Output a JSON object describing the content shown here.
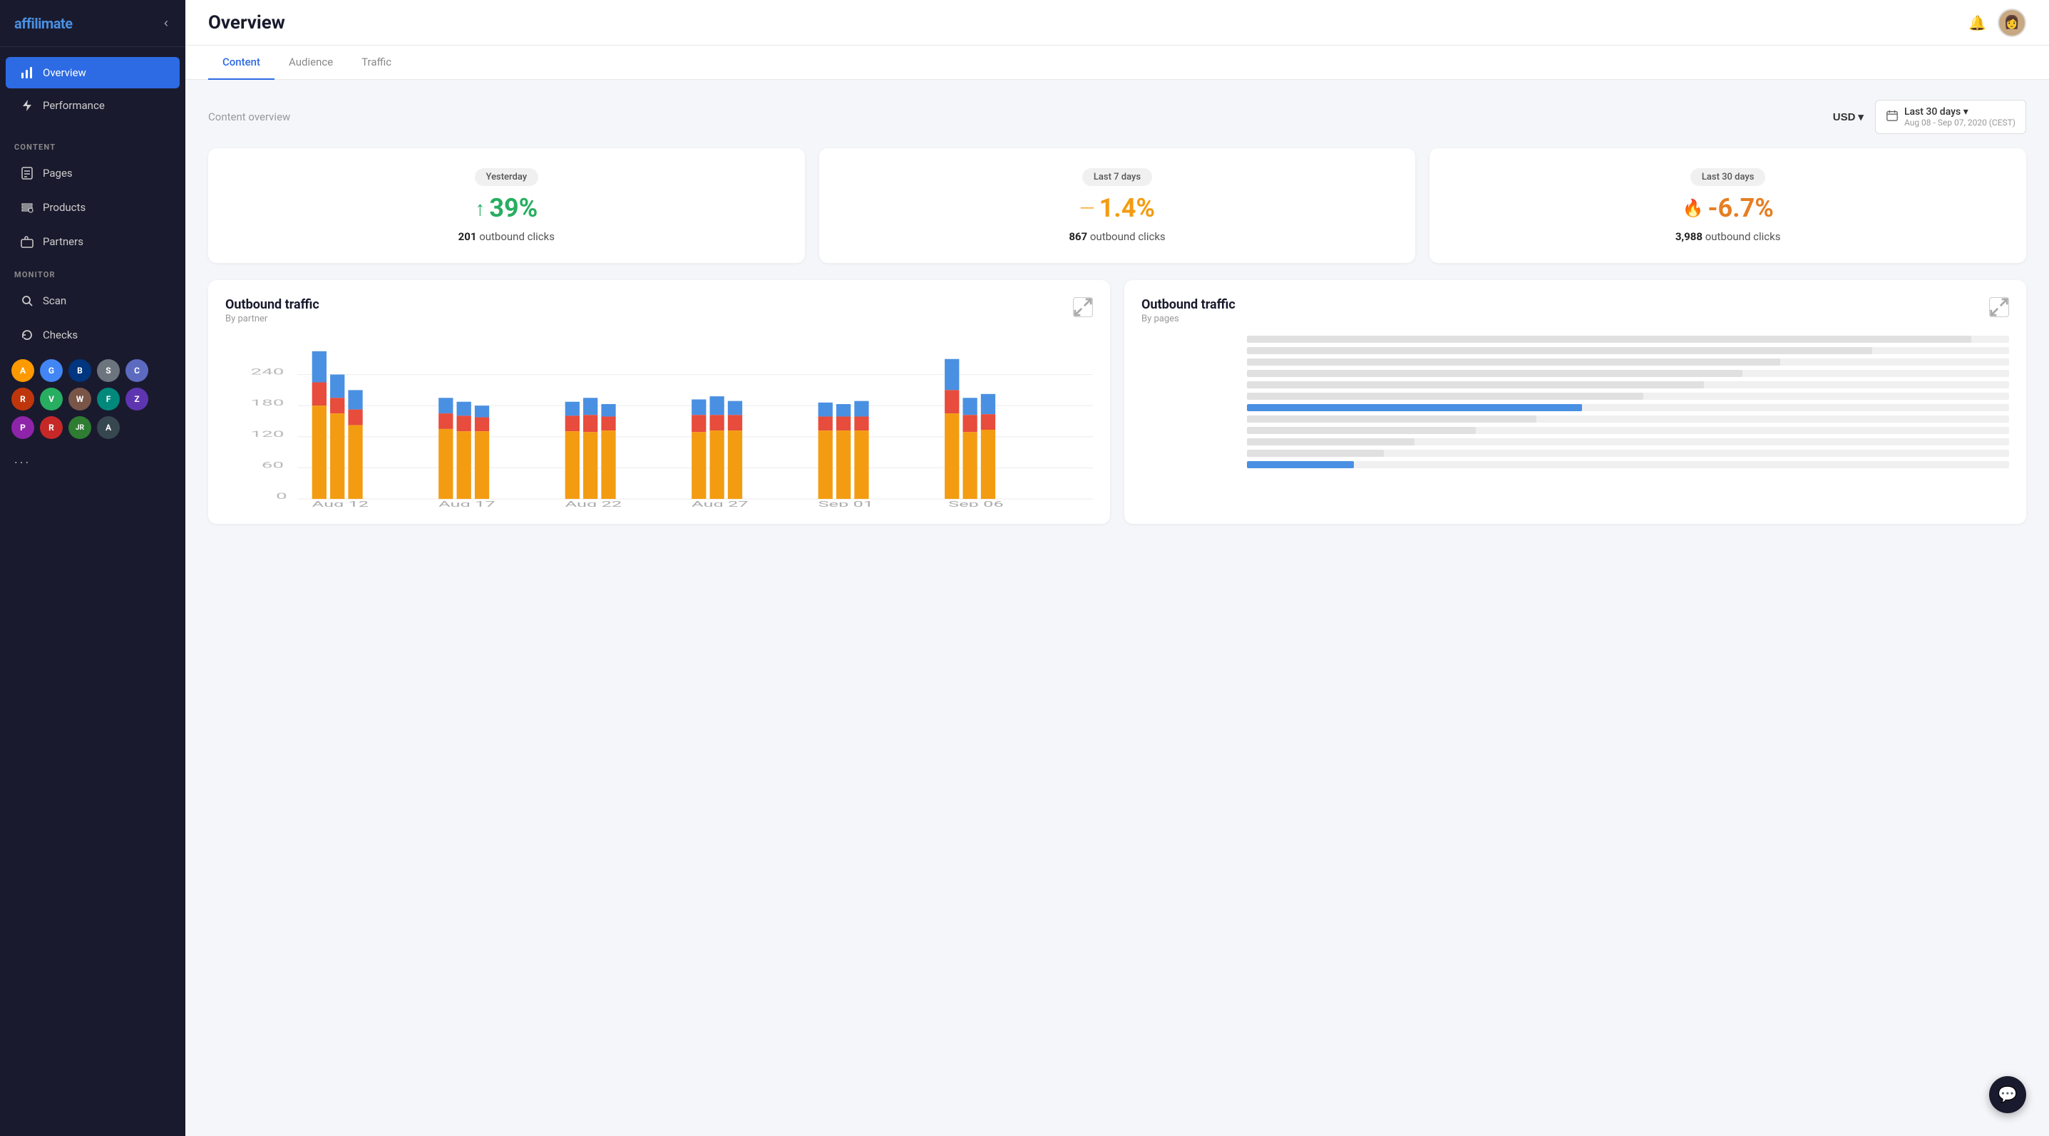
{
  "app": {
    "name": "affili",
    "name_accent": "mate"
  },
  "sidebar": {
    "collapse_label": "‹",
    "nav_items": [
      {
        "id": "overview",
        "label": "Overview",
        "active": true,
        "icon": "chart-bar"
      },
      {
        "id": "performance",
        "label": "Performance",
        "active": false,
        "icon": "lightning"
      }
    ],
    "sections": [
      {
        "label": "CONTENT",
        "items": [
          {
            "id": "pages",
            "label": "Pages",
            "icon": "page"
          },
          {
            "id": "products",
            "label": "Products",
            "icon": "products"
          },
          {
            "id": "partners",
            "label": "Partners",
            "icon": "briefcase"
          }
        ]
      },
      {
        "label": "MONITOR",
        "items": [
          {
            "id": "scan",
            "label": "Scan",
            "icon": "search"
          },
          {
            "id": "checks",
            "label": "Checks",
            "icon": "refresh"
          }
        ]
      }
    ],
    "partners": [
      {
        "id": "amazon",
        "label": "A",
        "color": "#FF9900"
      },
      {
        "id": "google",
        "label": "G",
        "color": "#4285F4"
      },
      {
        "id": "booking",
        "label": "B",
        "color": "#003580"
      },
      {
        "id": "shareasale",
        "label": "S",
        "color": "#6c757d"
      },
      {
        "id": "cj",
        "label": "C",
        "color": "#5c6bc0"
      },
      {
        "id": "rakuten",
        "label": "R",
        "color": "#bf360c"
      },
      {
        "id": "viator",
        "label": "V",
        "color": "#27ae60"
      },
      {
        "id": "p2",
        "label": "W",
        "color": "#795548"
      },
      {
        "id": "fp",
        "label": "F",
        "color": "#00897b"
      },
      {
        "id": "p3",
        "label": "Z",
        "color": "#5e35b1"
      },
      {
        "id": "p4",
        "label": "P",
        "color": "#8e24aa"
      },
      {
        "id": "p5",
        "label": "R",
        "color": "#c62828"
      },
      {
        "id": "p6",
        "label": "JR",
        "color": "#2e7d32"
      },
      {
        "id": "p7",
        "label": "A",
        "color": "#37474f"
      }
    ],
    "more_label": "..."
  },
  "header": {
    "title": "Overview",
    "bell_icon": "🔔"
  },
  "tabs": [
    {
      "id": "content",
      "label": "Content",
      "active": true
    },
    {
      "id": "audience",
      "label": "Audience",
      "active": false
    },
    {
      "id": "traffic",
      "label": "Traffic",
      "active": false
    }
  ],
  "controls": {
    "overview_label": "Content overview",
    "currency": "USD",
    "currency_arrow": "▾",
    "date_range": {
      "label": "Last 30 days",
      "arrow": "▾",
      "sub": "Aug 08 - Sep 07, 2020 (CEST)"
    }
  },
  "metric_cards": [
    {
      "badge": "Yesterday",
      "value": "39%",
      "trend": "up",
      "trend_color": "green",
      "arrow": "↑",
      "clicks_count": "201",
      "clicks_label": "outbound clicks"
    },
    {
      "badge": "Last 7 days",
      "value": "1.4%",
      "trend": "neutral",
      "trend_color": "yellow",
      "arrow": "—",
      "clicks_count": "867",
      "clicks_label": "outbound clicks"
    },
    {
      "badge": "Last 30 days",
      "value": "-6.7%",
      "trend": "down",
      "trend_color": "orange",
      "arrow": "🔥",
      "clicks_count": "3,988",
      "clicks_label": "outbound clicks"
    }
  ],
  "charts": [
    {
      "id": "outbound-by-partner",
      "title": "Outbound traffic",
      "subtitle": "By partner",
      "type": "stacked-bar",
      "y_labels": [
        "0",
        "60",
        "120",
        "180",
        "240"
      ],
      "x_labels": [
        "Aug 12",
        "Aug 17",
        "Aug 22",
        "Aug 27",
        "Sep 01",
        "Sep 06"
      ]
    },
    {
      "id": "outbound-by-page",
      "title": "Outbound traffic",
      "subtitle": "By pages",
      "type": "horizontal-bar",
      "bars": [
        {
          "label": "",
          "value": 95,
          "color": "#e0e0e0"
        },
        {
          "label": "",
          "value": 80,
          "color": "#e0e0e0"
        },
        {
          "label": "",
          "value": 70,
          "color": "#e0e0e0"
        },
        {
          "label": "",
          "value": 65,
          "color": "#e0e0e0"
        },
        {
          "label": "",
          "value": 60,
          "color": "#e0e0e0"
        },
        {
          "label": "",
          "value": 50,
          "color": "#e0e0e0"
        },
        {
          "label": "",
          "value": 42,
          "color": "#4a90e2"
        },
        {
          "label": "",
          "value": 38,
          "color": "#e0e0e0"
        },
        {
          "label": "",
          "value": 30,
          "color": "#e0e0e0"
        },
        {
          "label": "",
          "value": 22,
          "color": "#e0e0e0"
        },
        {
          "label": "",
          "value": 18,
          "color": "#e0e0e0"
        },
        {
          "label": "",
          "value": 14,
          "color": "#4a90e2"
        }
      ]
    }
  ],
  "chat": {
    "icon": "💬"
  }
}
